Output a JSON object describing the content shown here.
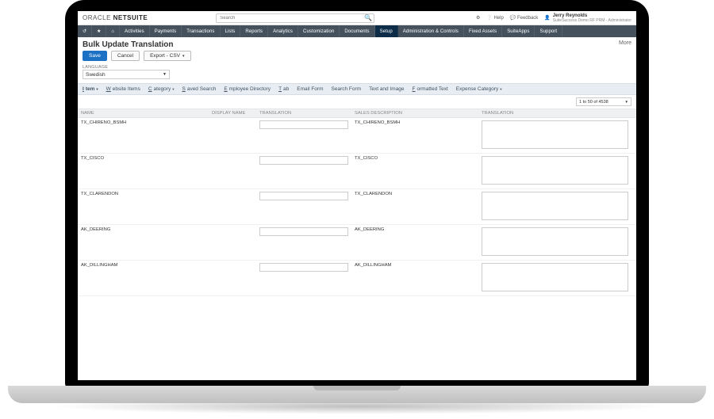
{
  "brand": {
    "oracle": "ORACLE",
    "netsuite": "NETSUITE"
  },
  "search": {
    "placeholder": "Search"
  },
  "top_links": {
    "help": "Help",
    "feedback": "Feedback"
  },
  "user": {
    "name": "Jerry Reynolds",
    "role": "SuiteSuccess Demo RF PRM - Administrator"
  },
  "nav": {
    "items": [
      "Activities",
      "Payments",
      "Transactions",
      "Lists",
      "Reports",
      "Analytics",
      "Customization",
      "Documents",
      "Setup",
      "Administration & Controls",
      "Fixed Assets",
      "SuiteApps",
      "Support"
    ],
    "active": "Setup"
  },
  "page": {
    "title": "Bulk Update Translation",
    "more": "More"
  },
  "buttons": {
    "save": "Save",
    "cancel": "Cancel",
    "export": "Export - CSV"
  },
  "language": {
    "label": "LANGUAGE",
    "value": "Swedish"
  },
  "subtabs": {
    "items": [
      {
        "label": "Item",
        "dd": true,
        "active": true,
        "u": "I"
      },
      {
        "label": "Website Items",
        "u": "W"
      },
      {
        "label": "Category",
        "dd": true,
        "u": "C"
      },
      {
        "label": "Saved Search",
        "u": "S"
      },
      {
        "label": "Employee Directory",
        "u": "E"
      },
      {
        "label": "Tab",
        "u": "T"
      },
      {
        "label": "Email Form"
      },
      {
        "label": "Search Form"
      },
      {
        "label": "Text and Image"
      },
      {
        "label": "Formatted Text",
        "u": "F"
      },
      {
        "label": "Expense Category",
        "dd": true
      }
    ]
  },
  "pager": {
    "value": "1 to 50 of 4538"
  },
  "columns": {
    "name": "NAME",
    "display": "DISPLAY NAME",
    "translation1": "TRANSLATION",
    "sales": "SALES DESCRIPTION",
    "translation2": "TRANSLATION"
  },
  "rows": [
    {
      "name": "TX_CHIRENO_BSMH",
      "sales": "TX_CHIRENO_BSMH"
    },
    {
      "name": "TX_CISCO",
      "sales": "TX_CISCO"
    },
    {
      "name": "TX_CLARENDON",
      "sales": "TX_CLARENDON"
    },
    {
      "name": "AK_DEERING",
      "sales": "AK_DEERING"
    },
    {
      "name": "AK_DILLINGHAM",
      "sales": "AK_DILLINGHAM"
    }
  ]
}
